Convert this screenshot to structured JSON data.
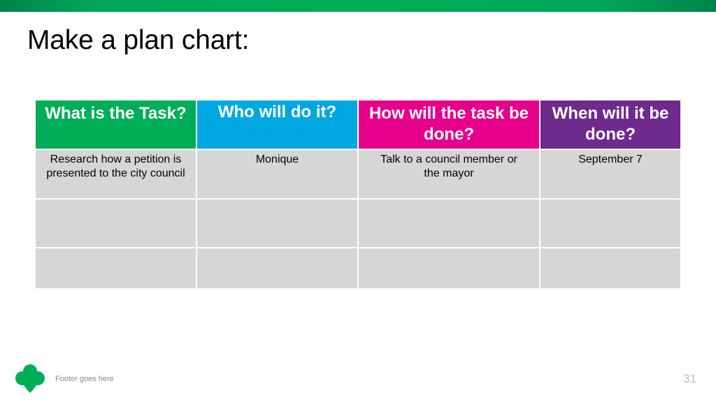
{
  "slide": {
    "title": "Make a plan chart:",
    "footer": "Footer goes here",
    "page_number": "31"
  },
  "colors": {
    "top_bar": "#00ae58",
    "header_task": "#00ae58",
    "header_who": "#00a8e1",
    "header_how": "#e6008c",
    "header_when": "#6e2a8d",
    "cell_bg": "#d6d6d6",
    "logo": "#00ae58"
  },
  "table": {
    "headers": [
      {
        "label": "What is the Task?",
        "color": "#00ae58"
      },
      {
        "label": "Who will do it?",
        "color": "#00a8e1"
      },
      {
        "label": "How will the task be done?",
        "color": "#e6008c"
      },
      {
        "label": "When will it be done?",
        "color": "#6e2a8d"
      }
    ],
    "rows": [
      [
        "Research how a petition is presented to the city council",
        "Monique",
        "Talk to a council member or the mayor",
        "September 7"
      ],
      [
        "",
        "",
        "",
        ""
      ],
      [
        "",
        "",
        "",
        ""
      ]
    ]
  },
  "icons": {
    "logo": "trefoil-logo-icon"
  }
}
